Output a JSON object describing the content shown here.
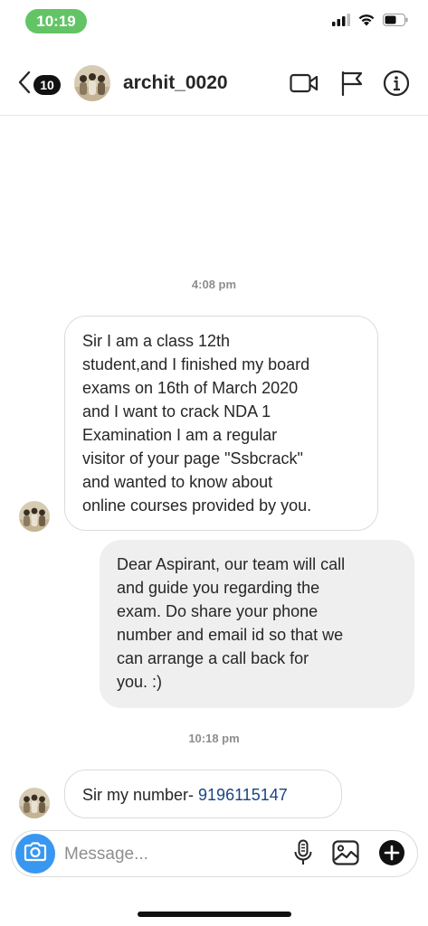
{
  "status_bar": {
    "time": "10:19",
    "icons": [
      "signal-icon",
      "wifi-icon",
      "battery-icon"
    ]
  },
  "header": {
    "unread_count": "10",
    "username": "archit_0020",
    "icons": [
      "back-chevron-icon",
      "video-call-icon",
      "flag-icon",
      "info-icon"
    ]
  },
  "chat": {
    "messages": [
      {
        "type": "timestamp",
        "text": "4:08 pm"
      },
      {
        "type": "incoming",
        "lines": [
          "Sir I am a class 12th",
          "student,and I finished my board",
          "exams on 16th of March 2020",
          "and I want to crack NDA 1",
          "Examination I am a regular",
          "visitor of your page \"Ssbcrack\"",
          "and wanted to know about",
          "online courses provided by you."
        ]
      },
      {
        "type": "outgoing",
        "lines": [
          "Dear Aspirant, our team will call",
          "and guide you regarding the",
          "exam. Do share your phone",
          "number and email id so that we",
          "can arrange a call back for",
          "you. :)"
        ]
      },
      {
        "type": "timestamp",
        "text": "10:18 pm"
      },
      {
        "type": "incoming",
        "prefix": "Sir my number- ",
        "link": "9196115147"
      }
    ]
  },
  "composer": {
    "placeholder": "Message...",
    "icons": [
      "camera-icon",
      "microphone-icon",
      "gallery-icon",
      "add-icon"
    ]
  },
  "colors": {
    "accent": "#3897f0",
    "status_pill": "#63c466",
    "link": "#1a4480",
    "outgoing_bubble": "#efefef"
  }
}
